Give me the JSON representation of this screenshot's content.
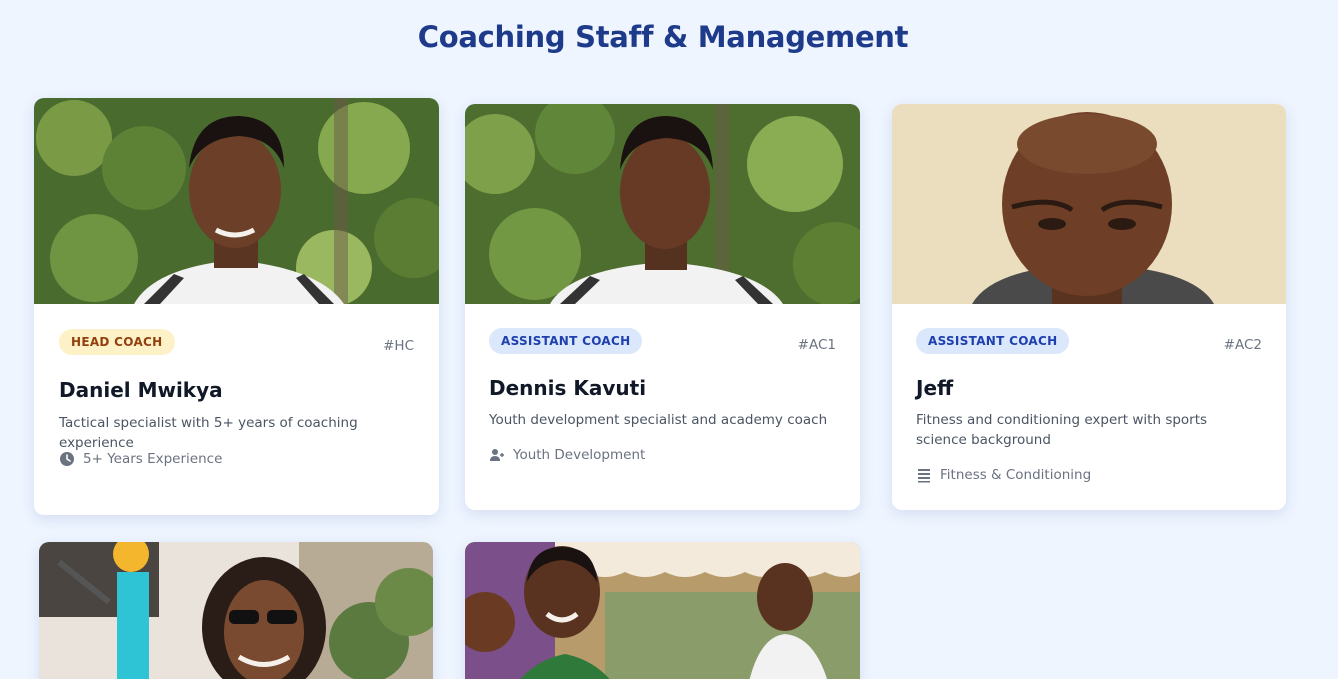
{
  "page": {
    "title": "Coaching Staff & Management"
  },
  "staff": [
    {
      "role": "HEAD COACH",
      "code": "#HC",
      "name": "Daniel Mwikya",
      "description": "Tactical specialist with 5+ years of coaching experience",
      "meta": "5+ Years Experience",
      "meta_icon": "clock-icon",
      "badge_color": "#fdf1c7"
    },
    {
      "role": "ASSISTANT COACH",
      "code": "#AC1",
      "name": "Dennis Kavuti",
      "description": "Youth development specialist and academy coach",
      "meta": "Youth Development",
      "meta_icon": "user-plus-icon",
      "badge_color": "#dbe7fb"
    },
    {
      "role": "ASSISTANT COACH",
      "code": "#AC2",
      "name": "Jeff",
      "description": "Fitness and conditioning expert with sports science background",
      "meta": "Fitness & Conditioning",
      "meta_icon": "list-icon",
      "badge_color": "#dbe7fb"
    },
    {
      "photo": "staff-photo-4"
    },
    {
      "photo": "staff-photo-5"
    }
  ],
  "colors": {
    "background": "#eef5ff",
    "title": "#1e3a8a",
    "card": "#ffffff"
  }
}
